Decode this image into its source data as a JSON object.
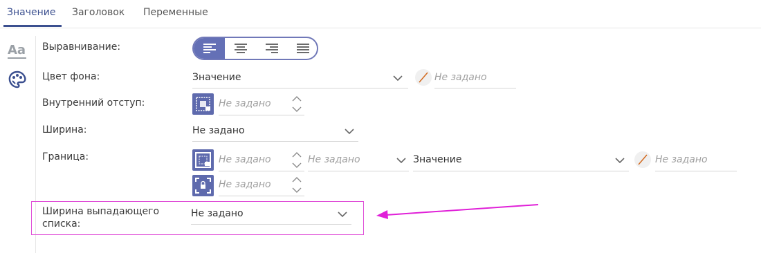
{
  "tabs": [
    {
      "label": "Значение"
    },
    {
      "label": "Заголовок"
    },
    {
      "label": "Переменные"
    }
  ],
  "rail": {
    "font_icon_label": "Aa"
  },
  "fields": {
    "alignment_label": "Выравнивание:",
    "bg_color_label": "Цвет фона:",
    "bg_color_value": "Значение",
    "bg_color_custom": "Не задано",
    "padding_label": "Внутренний отступ:",
    "padding_value": "Не задано",
    "width_label": "Ширина:",
    "width_value": "Не задано",
    "border_label": "Граница:",
    "border_width_value": "Не задано",
    "border_style_value": "Не задано",
    "border_color_value": "Значение",
    "border_color_custom": "Не задано",
    "border_radius_value": "Не задано",
    "dropdown_width_label_line1": "Ширина выпадающего",
    "dropdown_width_label_line2": "списка:",
    "dropdown_width_value": "Не задано"
  },
  "colors": {
    "accent": "#3b4f8f",
    "icon_bg": "#5e6aad",
    "highlight": "#e04fd8"
  },
  "icons": [
    "text-format-icon",
    "palette-icon",
    "align-left-icon",
    "align-center-icon",
    "align-right-icon",
    "align-justify-icon",
    "chevron-down-icon",
    "no-color-icon",
    "padding-icon",
    "border-icon",
    "border-radius-icon",
    "spin-up-icon",
    "spin-down-icon",
    "arrow-annotation-icon"
  ]
}
